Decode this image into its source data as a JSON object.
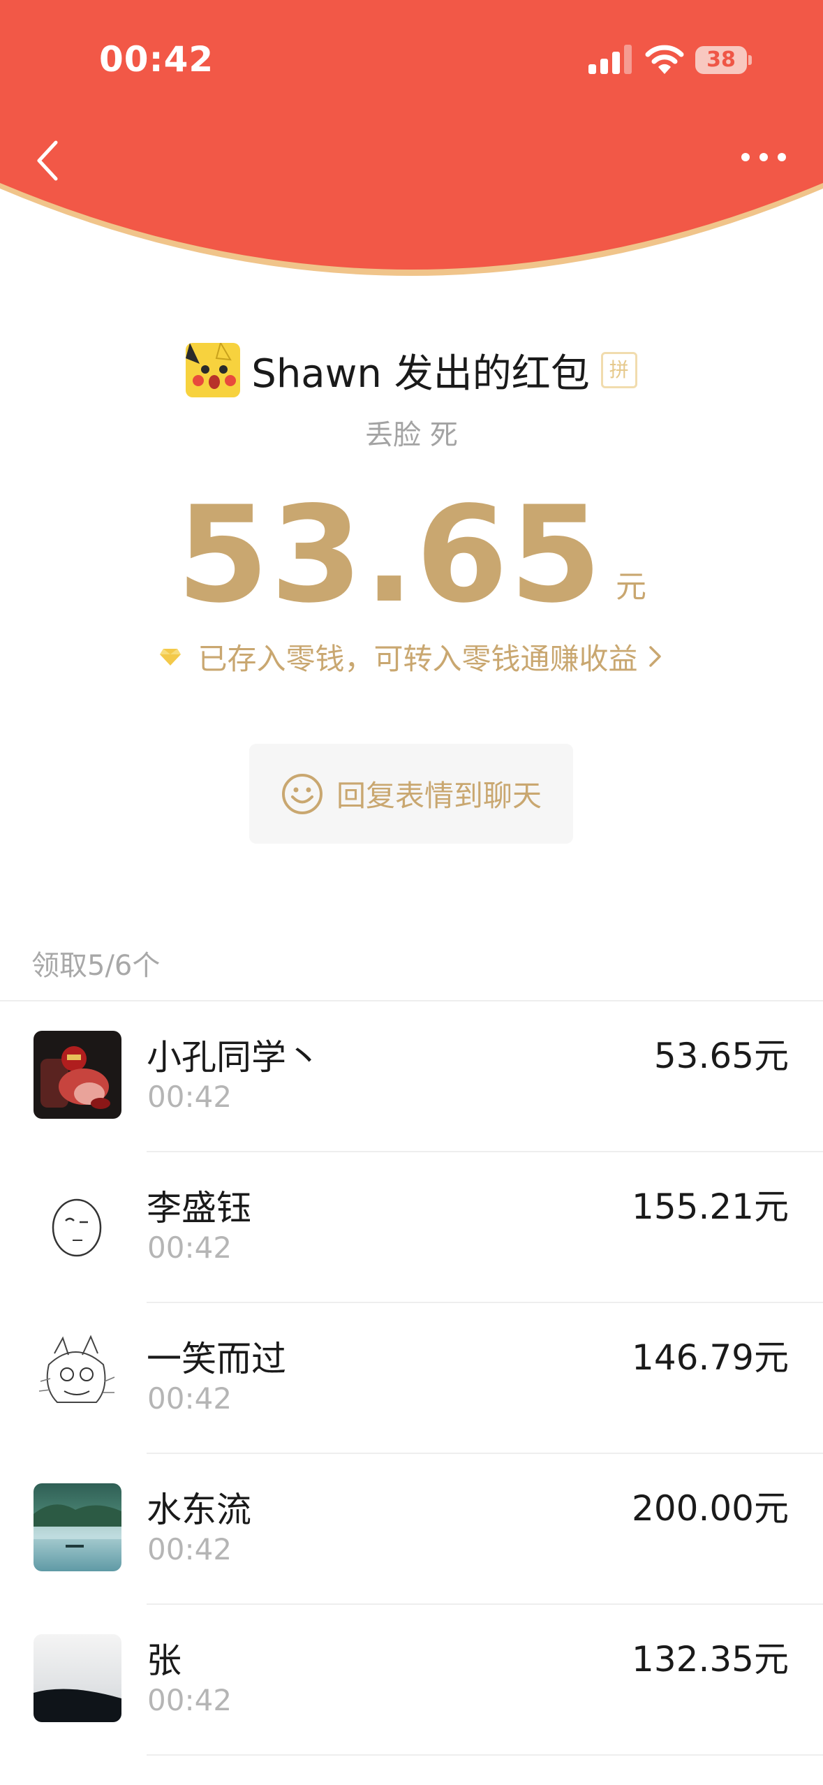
{
  "status_bar": {
    "time": "00:42",
    "battery": "38",
    "signal_icon": "cellular-signal-icon",
    "wifi_icon": "wifi-icon"
  },
  "nav": {
    "back_icon": "back-chevron-icon",
    "more_icon": "more-dots-icon"
  },
  "colors": {
    "header_red": "#F25847",
    "gold": "#C9A770",
    "header_rim": "#F0C48A"
  },
  "red_packet": {
    "title": "Shawn 发出的红包",
    "pin_badge": "拼",
    "blessing": "丢脸 死",
    "amount": "53.65",
    "amount_unit": "元",
    "saved_notice": "已存入零钱，可转入零钱通赚收益",
    "reply_button": "回复表情到聊天"
  },
  "list": {
    "received_count": "领取5/6个",
    "items": [
      {
        "name": "小孔同学丶",
        "time": "00:42",
        "amount": "53.65元"
      },
      {
        "name": "李盛钰",
        "time": "00:42",
        "amount": "155.21元"
      },
      {
        "name": "一笑而过",
        "time": "00:42",
        "amount": "146.79元"
      },
      {
        "name": "水东流",
        "time": "00:42",
        "amount": "200.00元"
      },
      {
        "name": "张",
        "time": "00:42",
        "amount": "132.35元"
      }
    ]
  }
}
